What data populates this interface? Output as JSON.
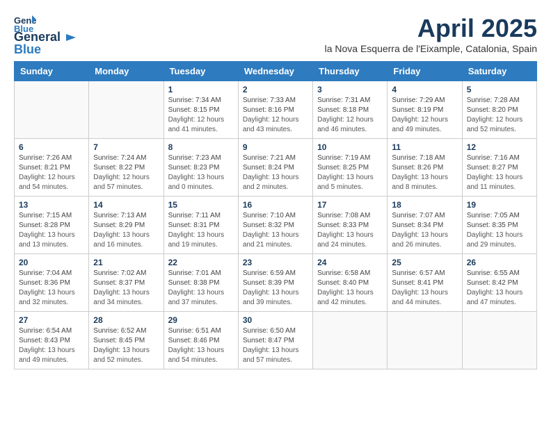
{
  "logo": {
    "line1": "General",
    "line2": "Blue"
  },
  "title": "April 2025",
  "subtitle": "la Nova Esquerra de l'Eixample, Catalonia, Spain",
  "weekdays": [
    "Sunday",
    "Monday",
    "Tuesday",
    "Wednesday",
    "Thursday",
    "Friday",
    "Saturday"
  ],
  "weeks": [
    [
      {
        "day": "",
        "info": ""
      },
      {
        "day": "",
        "info": ""
      },
      {
        "day": "1",
        "info": "Sunrise: 7:34 AM\nSunset: 8:15 PM\nDaylight: 12 hours and 41 minutes."
      },
      {
        "day": "2",
        "info": "Sunrise: 7:33 AM\nSunset: 8:16 PM\nDaylight: 12 hours and 43 minutes."
      },
      {
        "day": "3",
        "info": "Sunrise: 7:31 AM\nSunset: 8:18 PM\nDaylight: 12 hours and 46 minutes."
      },
      {
        "day": "4",
        "info": "Sunrise: 7:29 AM\nSunset: 8:19 PM\nDaylight: 12 hours and 49 minutes."
      },
      {
        "day": "5",
        "info": "Sunrise: 7:28 AM\nSunset: 8:20 PM\nDaylight: 12 hours and 52 minutes."
      }
    ],
    [
      {
        "day": "6",
        "info": "Sunrise: 7:26 AM\nSunset: 8:21 PM\nDaylight: 12 hours and 54 minutes."
      },
      {
        "day": "7",
        "info": "Sunrise: 7:24 AM\nSunset: 8:22 PM\nDaylight: 12 hours and 57 minutes."
      },
      {
        "day": "8",
        "info": "Sunrise: 7:23 AM\nSunset: 8:23 PM\nDaylight: 13 hours and 0 minutes."
      },
      {
        "day": "9",
        "info": "Sunrise: 7:21 AM\nSunset: 8:24 PM\nDaylight: 13 hours and 2 minutes."
      },
      {
        "day": "10",
        "info": "Sunrise: 7:19 AM\nSunset: 8:25 PM\nDaylight: 13 hours and 5 minutes."
      },
      {
        "day": "11",
        "info": "Sunrise: 7:18 AM\nSunset: 8:26 PM\nDaylight: 13 hours and 8 minutes."
      },
      {
        "day": "12",
        "info": "Sunrise: 7:16 AM\nSunset: 8:27 PM\nDaylight: 13 hours and 11 minutes."
      }
    ],
    [
      {
        "day": "13",
        "info": "Sunrise: 7:15 AM\nSunset: 8:28 PM\nDaylight: 13 hours and 13 minutes."
      },
      {
        "day": "14",
        "info": "Sunrise: 7:13 AM\nSunset: 8:29 PM\nDaylight: 13 hours and 16 minutes."
      },
      {
        "day": "15",
        "info": "Sunrise: 7:11 AM\nSunset: 8:31 PM\nDaylight: 13 hours and 19 minutes."
      },
      {
        "day": "16",
        "info": "Sunrise: 7:10 AM\nSunset: 8:32 PM\nDaylight: 13 hours and 21 minutes."
      },
      {
        "day": "17",
        "info": "Sunrise: 7:08 AM\nSunset: 8:33 PM\nDaylight: 13 hours and 24 minutes."
      },
      {
        "day": "18",
        "info": "Sunrise: 7:07 AM\nSunset: 8:34 PM\nDaylight: 13 hours and 26 minutes."
      },
      {
        "day": "19",
        "info": "Sunrise: 7:05 AM\nSunset: 8:35 PM\nDaylight: 13 hours and 29 minutes."
      }
    ],
    [
      {
        "day": "20",
        "info": "Sunrise: 7:04 AM\nSunset: 8:36 PM\nDaylight: 13 hours and 32 minutes."
      },
      {
        "day": "21",
        "info": "Sunrise: 7:02 AM\nSunset: 8:37 PM\nDaylight: 13 hours and 34 minutes."
      },
      {
        "day": "22",
        "info": "Sunrise: 7:01 AM\nSunset: 8:38 PM\nDaylight: 13 hours and 37 minutes."
      },
      {
        "day": "23",
        "info": "Sunrise: 6:59 AM\nSunset: 8:39 PM\nDaylight: 13 hours and 39 minutes."
      },
      {
        "day": "24",
        "info": "Sunrise: 6:58 AM\nSunset: 8:40 PM\nDaylight: 13 hours and 42 minutes."
      },
      {
        "day": "25",
        "info": "Sunrise: 6:57 AM\nSunset: 8:41 PM\nDaylight: 13 hours and 44 minutes."
      },
      {
        "day": "26",
        "info": "Sunrise: 6:55 AM\nSunset: 8:42 PM\nDaylight: 13 hours and 47 minutes."
      }
    ],
    [
      {
        "day": "27",
        "info": "Sunrise: 6:54 AM\nSunset: 8:43 PM\nDaylight: 13 hours and 49 minutes."
      },
      {
        "day": "28",
        "info": "Sunrise: 6:52 AM\nSunset: 8:45 PM\nDaylight: 13 hours and 52 minutes."
      },
      {
        "day": "29",
        "info": "Sunrise: 6:51 AM\nSunset: 8:46 PM\nDaylight: 13 hours and 54 minutes."
      },
      {
        "day": "30",
        "info": "Sunrise: 6:50 AM\nSunset: 8:47 PM\nDaylight: 13 hours and 57 minutes."
      },
      {
        "day": "",
        "info": ""
      },
      {
        "day": "",
        "info": ""
      },
      {
        "day": "",
        "info": ""
      }
    ]
  ]
}
